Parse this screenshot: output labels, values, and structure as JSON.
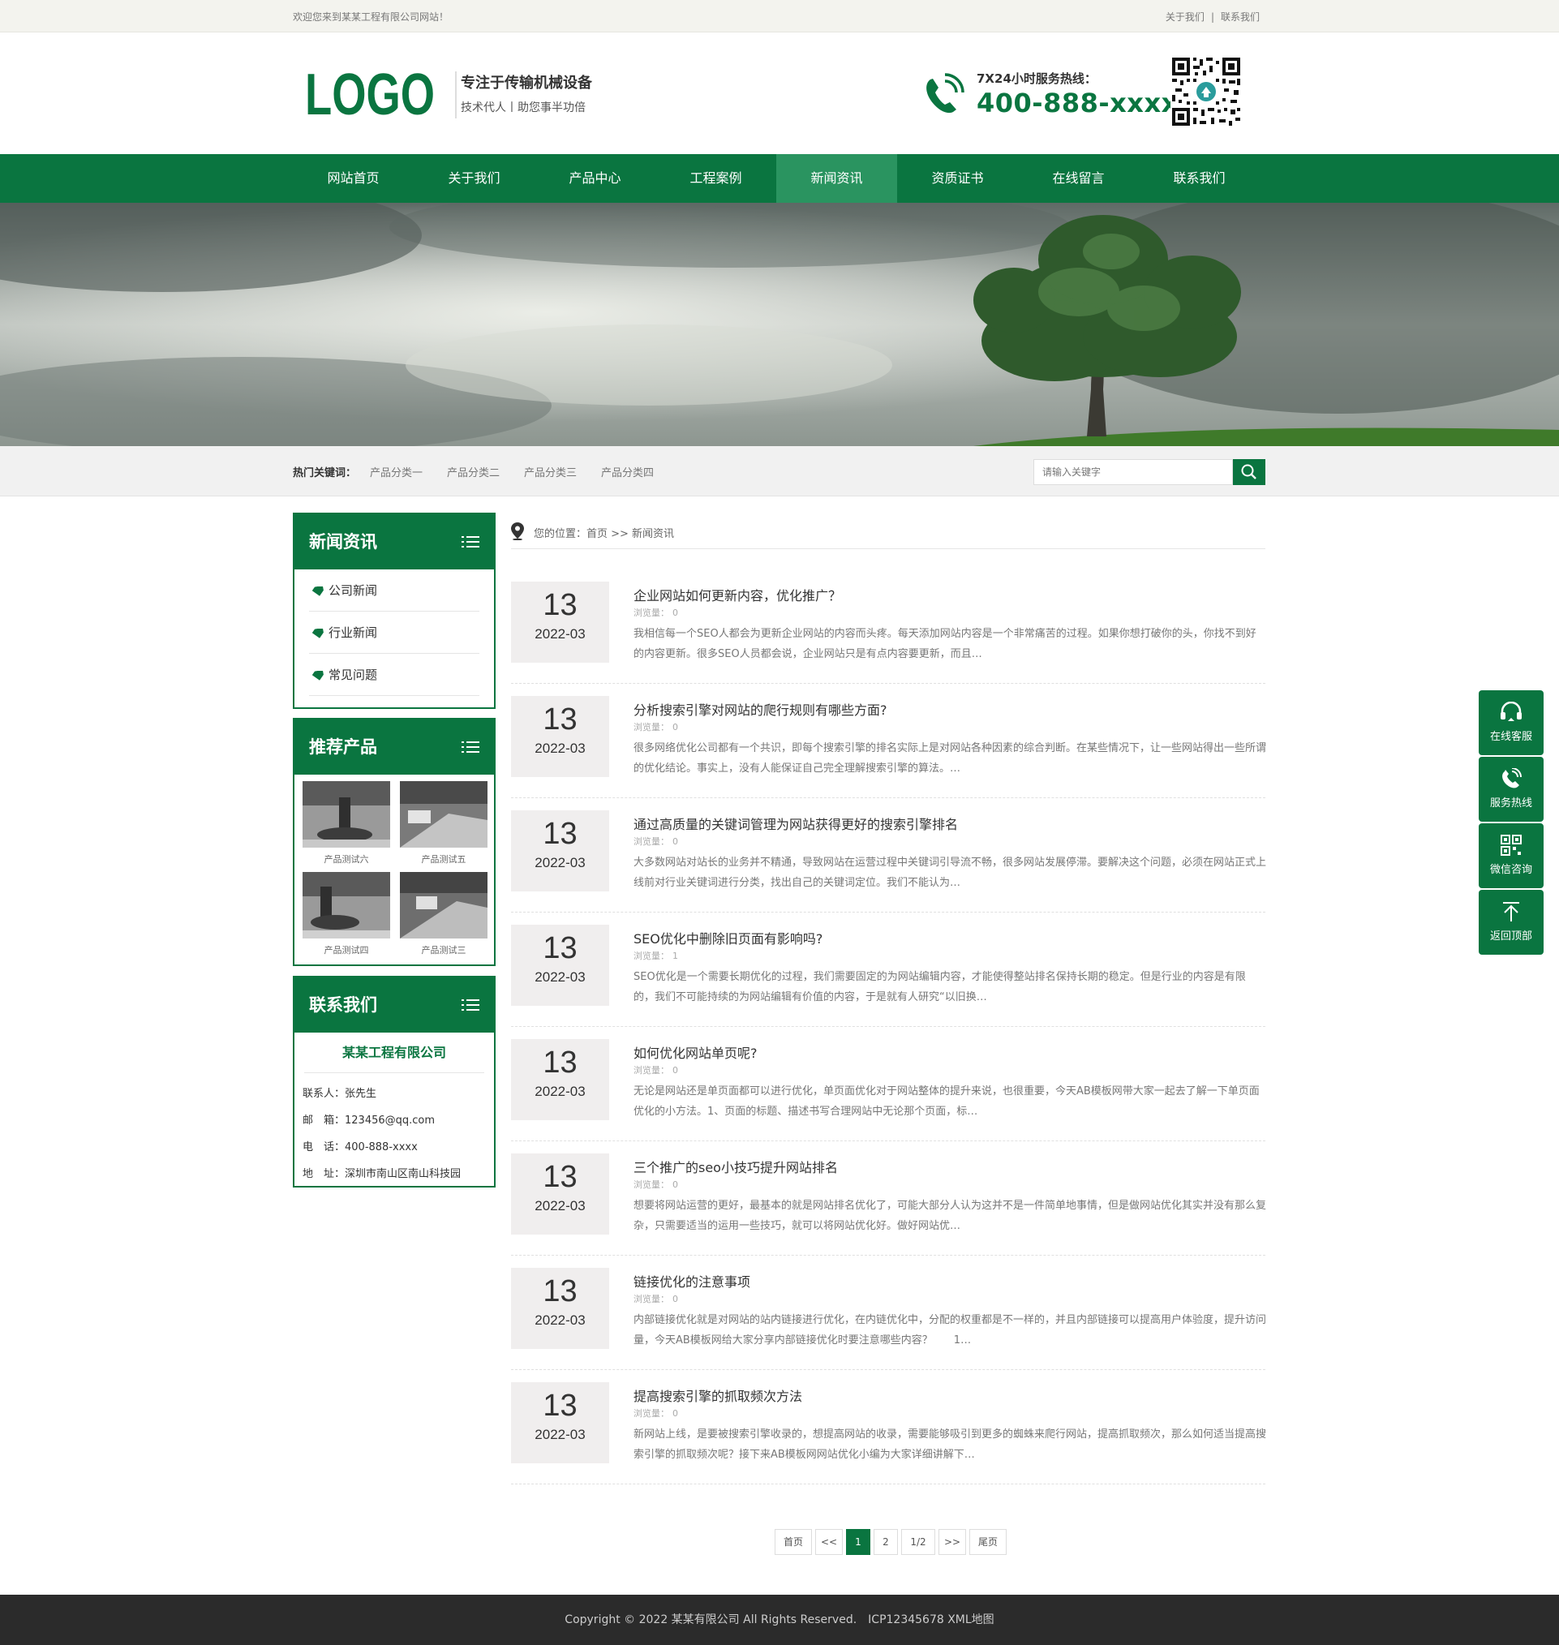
{
  "topbar": {
    "welcome": "欢迎您来到某某工程有限公司网站！",
    "link_about": "关于我们",
    "separator": "|",
    "link_contact": "联系我们"
  },
  "header": {
    "logo_text": "LOGO",
    "slogan_main": "专注于传输机械设备",
    "slogan_sub": "技术代人丨助您事半功倍",
    "hotline_label": "7X24小时服务热线：",
    "hotline_number": "400-888-xxxx"
  },
  "nav": {
    "items": [
      {
        "label": "网站首页"
      },
      {
        "label": "关于我们"
      },
      {
        "label": "产品中心"
      },
      {
        "label": "工程案例"
      },
      {
        "label": "新闻资讯"
      },
      {
        "label": "资质证书"
      },
      {
        "label": "在线留言"
      },
      {
        "label": "联系我们"
      }
    ],
    "active_index": 4
  },
  "keywords": {
    "title": "热门关键词：",
    "items": [
      "产品分类一",
      "产品分类二",
      "产品分类三",
      "产品分类四"
    ],
    "search_placeholder": "请输入关键字"
  },
  "sidebar": {
    "news_title": "新闻资讯",
    "categories": [
      "公司新闻",
      "行业新闻",
      "常见问题"
    ],
    "products_title": "推荐产品",
    "products": [
      "产品测试六",
      "产品测试五",
      "产品测试四",
      "产品测试三"
    ],
    "contact_title": "联系我们",
    "company": "某某工程有限公司",
    "contact_lines": [
      "联系人：张先生",
      "邮　箱：123456@qq.com",
      "电　话：400-888-xxxx",
      "地　址：深圳市南山区南山科技园"
    ]
  },
  "breadcrumb": "您的位置：首页 >> 新闻资讯",
  "news": [
    {
      "day": "13",
      "ym": "2022-03",
      "title": "企业网站如何更新内容，优化推广？",
      "views_label": "浏览量：",
      "views": "0",
      "desc": "我相信每一个SEO人都会为更新企业网站的内容而头疼。每天添加网站内容是一个非常痛苦的过程。如果你想打破你的头，你找不到好的内容更新。很多SEO人员都会说，企业网站只是有点内容要更新，而且…"
    },
    {
      "day": "13",
      "ym": "2022-03",
      "title": "分析搜索引擎对网站的爬行规则有哪些方面?",
      "views_label": "浏览量：",
      "views": "0",
      "desc": "很多网络优化公司都有一个共识，即每个搜索引擎的排名实际上是对网站各种因素的综合判断。在某些情况下，让一些网站得出一些所谓的优化结论。事实上，没有人能保证自己完全理解搜索引擎的算法。…"
    },
    {
      "day": "13",
      "ym": "2022-03",
      "title": "通过高质量的关键词管理为网站获得更好的搜索引擎排名",
      "views_label": "浏览量：",
      "views": "0",
      "desc": "大多数网站对站长的业务并不精通，导致网站在运营过程中关键词引导流不畅，很多网站发展停滞。要解决这个问题，必须在网站正式上线前对行业关键词进行分类，找出自己的关键词定位。我们不能认为…"
    },
    {
      "day": "13",
      "ym": "2022-03",
      "title": "SEO优化中删除旧页面有影响吗?",
      "views_label": "浏览量：",
      "views": "1",
      "desc": "SEO优化是一个需要长期优化的过程，我们需要固定的为网站编辑内容，才能使得整站排名保持长期的稳定。但是行业的内容是有限的，我们不可能持续的为网站编辑有价值的内容，于是就有人研究“以旧换…"
    },
    {
      "day": "13",
      "ym": "2022-03",
      "title": "如何优化网站单页呢?",
      "views_label": "浏览量：",
      "views": "0",
      "desc": "无论是网站还是单页面都可以进行优化，单页面优化对于网站整体的提升来说，也很重要，今天AB模板网带大家一起去了解一下单页面优化的小方法。1、页面的标题、描述书写合理网站中无论那个页面，标…"
    },
    {
      "day": "13",
      "ym": "2022-03",
      "title": "三个推广的seo小技巧提升网站排名",
      "views_label": "浏览量：",
      "views": "0",
      "desc": "想要将网站运营的更好，最基本的就是网站排名优化了，可能大部分人认为这并不是一件简单地事情，但是做网站优化其实并没有那么复杂，只需要适当的运用一些技巧，就可以将网站优化好。做好网站优…"
    },
    {
      "day": "13",
      "ym": "2022-03",
      "title": "链接优化的注意事项",
      "views_label": "浏览量：",
      "views": "0",
      "desc": "内部链接优化就是对网站的站内链接进行优化，在内链优化中，分配的权重都是不一样的，并且内部链接可以提高用户体验度，提升访问量，今天AB模板网给大家分享内部链接优化时要注意哪些内容？　　1…"
    },
    {
      "day": "13",
      "ym": "2022-03",
      "title": "提高搜索引擎的抓取频次方法",
      "views_label": "浏览量：",
      "views": "0",
      "desc": "新网站上线，是要被搜索引擎收录的，想提高网站的收录，需要能够吸引到更多的蜘蛛来爬行网站，提高抓取频次，那么如何适当提高搜索引擎的抓取频次呢？接下来AB模板网网站优化小编为大家详细讲解下…"
    }
  ],
  "pagination": {
    "first": "首页",
    "prev": "<<",
    "pages": [
      "1",
      "2"
    ],
    "current": "1",
    "info": "1/2",
    "next": ">>",
    "last": "尾页"
  },
  "footer": "Copyright © 2022 某某有限公司 All Rights Reserved.　ICP12345678 XML地图",
  "float_tools": [
    "在线客服",
    "服务热线",
    "微信咨询",
    "返回顶部"
  ],
  "colors": {
    "brand_green": "#0a7540",
    "nav_active": "#2a9460",
    "footer_bg": "#2b2b2b"
  }
}
